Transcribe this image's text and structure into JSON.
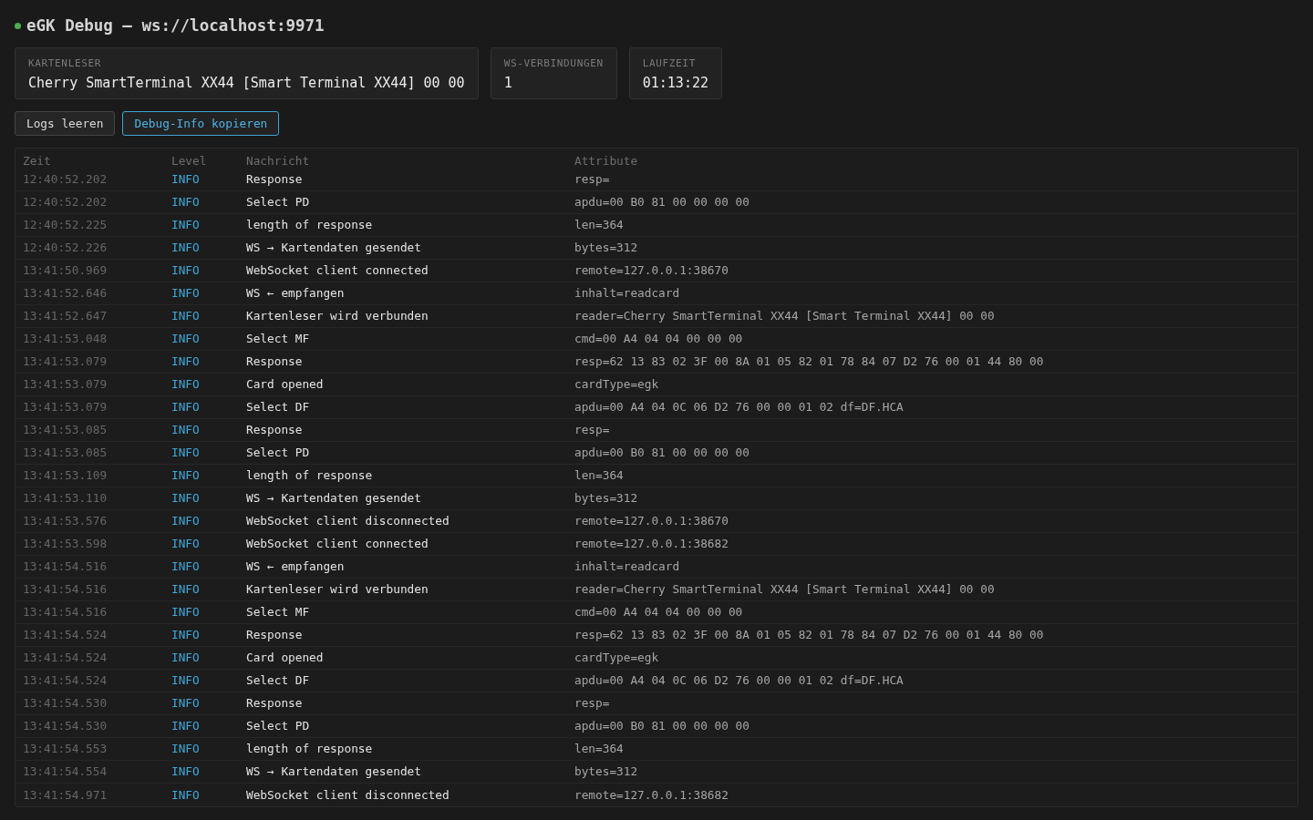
{
  "header": {
    "title": "eGK Debug — ws://localhost:9971",
    "connected": true
  },
  "stats": [
    {
      "label": "KARTENLESER",
      "value": "Cherry SmartTerminal XX44 [Smart Terminal XX44] 00 00"
    },
    {
      "label": "WS-VERBINDUNGEN",
      "value": "1"
    },
    {
      "label": "LAUFZEIT",
      "value": "01:13:22"
    }
  ],
  "buttons": [
    {
      "label": "Logs leeren",
      "kind": "secondary"
    },
    {
      "label": "Debug-Info kopieren",
      "kind": "primary"
    }
  ],
  "log_table": {
    "columns": [
      "Zeit",
      "Level",
      "Nachricht",
      "Attribute"
    ],
    "rows": [
      {
        "time": "12:40:52.202",
        "level": "INFO",
        "message": "Response",
        "attributes": "resp="
      },
      {
        "time": "12:40:52.202",
        "level": "INFO",
        "message": "Select PD",
        "attributes": "apdu=00 B0 81 00 00 00 00"
      },
      {
        "time": "12:40:52.225",
        "level": "INFO",
        "message": "length of response",
        "attributes": "len=364"
      },
      {
        "time": "12:40:52.226",
        "level": "INFO",
        "message": "WS → Kartendaten gesendet",
        "attributes": "bytes=312"
      },
      {
        "time": "13:41:50.969",
        "level": "INFO",
        "message": "WebSocket client connected",
        "attributes": "remote=127.0.0.1:38670"
      },
      {
        "time": "13:41:52.646",
        "level": "INFO",
        "message": "WS ← empfangen",
        "attributes": "inhalt=readcard"
      },
      {
        "time": "13:41:52.647",
        "level": "INFO",
        "message": "Kartenleser wird verbunden",
        "attributes": "reader=Cherry SmartTerminal XX44 [Smart Terminal XX44] 00 00"
      },
      {
        "time": "13:41:53.048",
        "level": "INFO",
        "message": "Select MF",
        "attributes": "cmd=00 A4 04 04 00 00 00"
      },
      {
        "time": "13:41:53.079",
        "level": "INFO",
        "message": "Response",
        "attributes": "resp=62 13 83 02 3F 00 8A 01 05 82 01 78 84 07 D2 76 00 01 44 80 00"
      },
      {
        "time": "13:41:53.079",
        "level": "INFO",
        "message": "Card opened",
        "attributes": "cardType=egk"
      },
      {
        "time": "13:41:53.079",
        "level": "INFO",
        "message": "Select DF",
        "attributes": "apdu=00 A4 04 0C 06 D2 76 00 00 01 02 df=DF.HCA"
      },
      {
        "time": "13:41:53.085",
        "level": "INFO",
        "message": "Response",
        "attributes": "resp="
      },
      {
        "time": "13:41:53.085",
        "level": "INFO",
        "message": "Select PD",
        "attributes": "apdu=00 B0 81 00 00 00 00"
      },
      {
        "time": "13:41:53.109",
        "level": "INFO",
        "message": "length of response",
        "attributes": "len=364"
      },
      {
        "time": "13:41:53.110",
        "level": "INFO",
        "message": "WS → Kartendaten gesendet",
        "attributes": "bytes=312"
      },
      {
        "time": "13:41:53.576",
        "level": "INFO",
        "message": "WebSocket client disconnected",
        "attributes": "remote=127.0.0.1:38670"
      },
      {
        "time": "13:41:53.598",
        "level": "INFO",
        "message": "WebSocket client connected",
        "attributes": "remote=127.0.0.1:38682"
      },
      {
        "time": "13:41:54.516",
        "level": "INFO",
        "message": "WS ← empfangen",
        "attributes": "inhalt=readcard"
      },
      {
        "time": "13:41:54.516",
        "level": "INFO",
        "message": "Kartenleser wird verbunden",
        "attributes": "reader=Cherry SmartTerminal XX44 [Smart Terminal XX44] 00 00"
      },
      {
        "time": "13:41:54.516",
        "level": "INFO",
        "message": "Select MF",
        "attributes": "cmd=00 A4 04 04 00 00 00"
      },
      {
        "time": "13:41:54.524",
        "level": "INFO",
        "message": "Response",
        "attributes": "resp=62 13 83 02 3F 00 8A 01 05 82 01 78 84 07 D2 76 00 01 44 80 00"
      },
      {
        "time": "13:41:54.524",
        "level": "INFO",
        "message": "Card opened",
        "attributes": "cardType=egk"
      },
      {
        "time": "13:41:54.524",
        "level": "INFO",
        "message": "Select DF",
        "attributes": "apdu=00 A4 04 0C 06 D2 76 00 00 01 02 df=DF.HCA"
      },
      {
        "time": "13:41:54.530",
        "level": "INFO",
        "message": "Response",
        "attributes": "resp="
      },
      {
        "time": "13:41:54.530",
        "level": "INFO",
        "message": "Select PD",
        "attributes": "apdu=00 B0 81 00 00 00 00"
      },
      {
        "time": "13:41:54.553",
        "level": "INFO",
        "message": "length of response",
        "attributes": "len=364"
      },
      {
        "time": "13:41:54.554",
        "level": "INFO",
        "message": "WS → Kartendaten gesendet",
        "attributes": "bytes=312"
      },
      {
        "time": "13:41:54.971",
        "level": "INFO",
        "message": "WebSocket client disconnected",
        "attributes": "remote=127.0.0.1:38682"
      }
    ]
  }
}
